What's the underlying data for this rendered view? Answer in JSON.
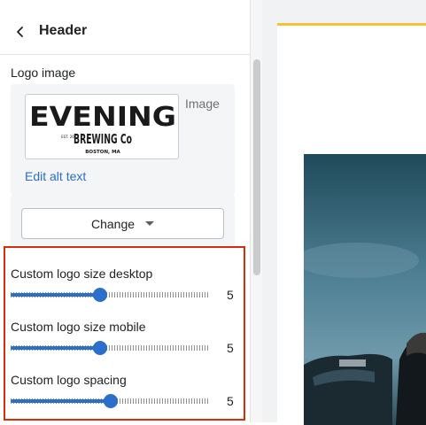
{
  "header": {
    "title": "Header"
  },
  "logo": {
    "section_label": "Logo image",
    "image_label": "Image",
    "edit_alt_text": "Edit alt text",
    "change_button": "Change",
    "wordmark_line1": "EVENING",
    "wordmark_line2": "BREWING Co",
    "wordmark_est": "EST. 2013",
    "wordmark_city": "BOSTON, MA"
  },
  "sliders": [
    {
      "label": "Custom logo size desktop",
      "value": "5",
      "fill_fraction": 0.45
    },
    {
      "label": "Custom logo size mobile",
      "value": "5",
      "fill_fraction": 0.45
    },
    {
      "label": "Custom logo spacing",
      "value": "5",
      "fill_fraction": 0.5
    }
  ],
  "colors": {
    "accent": "#2c6ecb",
    "highlight_border": "#d82c0d",
    "preview_top_bar": "#f2c434"
  },
  "icons": {
    "back": "chevron-left-icon",
    "dropdown": "caret-down-icon"
  }
}
